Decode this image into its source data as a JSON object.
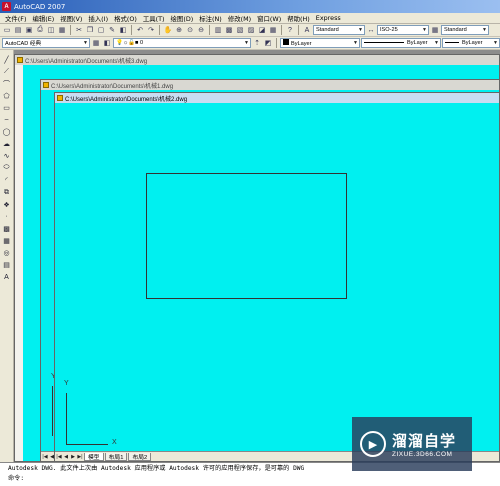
{
  "app": {
    "title": "AutoCAD 2007",
    "icon": "autocad-logo-icon"
  },
  "menu": [
    "文件(F)",
    "编辑(E)",
    "视图(V)",
    "插入(I)",
    "格式(O)",
    "工具(T)",
    "绘图(D)",
    "标注(N)",
    "修改(M)",
    "窗口(W)",
    "帮助(H)",
    "Express"
  ],
  "toolbar": {
    "text_style": "Standard",
    "dim_style": "ISO-25",
    "table_style": "Standard",
    "workspace": "AutoCAD 经典",
    "layer": "0",
    "color": "ByLayer",
    "linetype": "ByLayer",
    "lineweight": "ByLayer"
  },
  "documents": [
    {
      "title": "C:\\Users\\Administrator\\Documents\\机械3.dwg"
    },
    {
      "title": "C:\\Users\\Administrator\\Documents\\机械1.dwg"
    },
    {
      "title": "C:\\Users\\Administrator\\Documents\\机械2.dwg"
    }
  ],
  "ucs": {
    "y": "Y",
    "x": "X"
  },
  "tabs": {
    "model": "模型",
    "layout1": "布局1",
    "layout2": "布局2"
  },
  "command_line": {
    "history": "Autodesk DWG.  此文件上次由 Autodesk 应用程序或 Autodesk 许可的应用程序保存，是可靠的 DWG",
    "prompt": "命令:"
  },
  "watermark": {
    "title": "溜溜自学",
    "url": "ZIXUE.3D66.COM"
  },
  "colors": {
    "canvas": "#00f0f0",
    "titlebar": "#2a5fb8"
  }
}
